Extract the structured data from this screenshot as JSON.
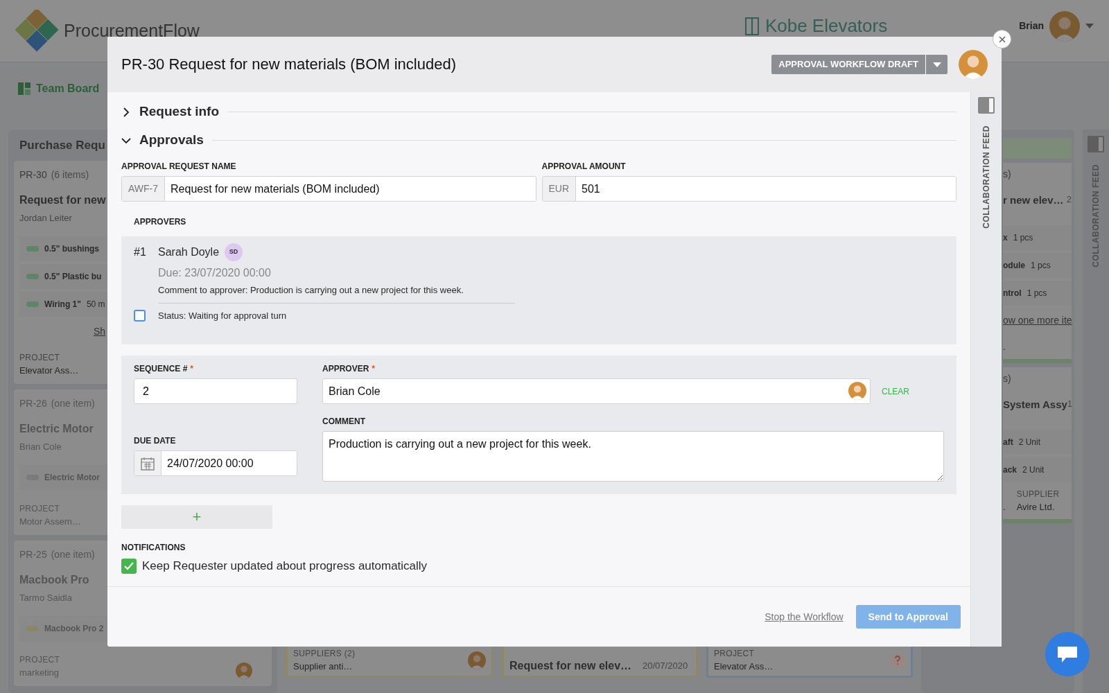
{
  "app": {
    "name": "ProcurementFlow",
    "company": "Kobe Elevators",
    "user": "Brian"
  },
  "nav": {
    "board": "Team Board"
  },
  "left_column": {
    "title": "Purchase Requ",
    "cards": [
      {
        "id": "PR-30",
        "count": "(6 items)",
        "title": "Request for new",
        "requester": "Jordan Leiter",
        "faded": false,
        "items": [
          {
            "name": "0.5\" bushings",
            "color": "#5f8466"
          },
          {
            "name": "0.5\" Plastic bu",
            "color": "#5f8466"
          },
          {
            "name": "Wiring 1\"",
            "qty": "50 m",
            "color": "#5f8466"
          }
        ],
        "link": "Sh",
        "field_label": "PROJECT",
        "field_value": "Elevator Ass…"
      },
      {
        "id": "PR-26",
        "count": "(one item)",
        "title": "Electric Motor",
        "requester": "Brian Cole",
        "faded": true,
        "items": [
          {
            "name": "Electric Motor",
            "color": "#7b7b7b"
          }
        ],
        "field_label": "PROJECT",
        "field_value": "Motor Assem…"
      },
      {
        "id": "PR-25",
        "count": "(one item)",
        "title": "Macbook Pro",
        "requester": "Tarmo Saidla",
        "faded": true,
        "items": [
          {
            "name": "Macbook Pro 2",
            "color": "#8d8666"
          }
        ],
        "field_label": "PROJECT",
        "field_value": "marketing",
        "avatar": true
      }
    ]
  },
  "bottom_cards": [
    {
      "kind": "supplier",
      "label": "SUPPLIERS (2)",
      "value": "Supplier anti…",
      "color": "#8f8766"
    },
    {
      "kind": "request",
      "title": "Request for new elev…",
      "date": "20/07/2020",
      "color": "#8f8766"
    },
    {
      "kind": "project",
      "label": "PROJECT",
      "value": "Elevator Ass…",
      "color": "#6f8092"
    }
  ],
  "right_column": {
    "cards": [
      {
        "count": "s)",
        "title": "r new elev…",
        "date": "2",
        "items": [
          {
            "name": "x",
            "qty": "1 pcs"
          },
          {
            "name": "odule",
            "qty": "1 pcs"
          },
          {
            "name": "ntrol",
            "qty": "1 pcs"
          }
        ],
        "link": "ow one more ite",
        "fields": [
          {
            "value": "."
          }
        ]
      },
      {
        "count": "s)",
        "title": "System Assy",
        "date": "1",
        "items": [
          {
            "name": "aft",
            "qty": "2 Unit"
          },
          {
            "name": "ack",
            "qty": "2 Unit"
          }
        ],
        "fields": [
          {
            "value": "."
          },
          {
            "label": "SUPPLIER",
            "value": "Avire Ltd."
          }
        ]
      }
    ]
  },
  "right_sidebar": {
    "label": "COLLABORATION FEED"
  },
  "modal": {
    "title": "PR-30 Request for new materials (BOM included)",
    "status_button": "APPROVAL WORKFLOW DRAFT",
    "sections": [
      {
        "title": "Request info",
        "expanded": false
      },
      {
        "title": "Approvals",
        "expanded": true
      }
    ],
    "request_name": {
      "label": "APPROVAL REQUEST NAME",
      "prefix": "AWF-7",
      "value": "Request for new materials (BOM included)"
    },
    "amount": {
      "label": "APPROVAL AMOUNT",
      "prefix": "EUR",
      "value": "501"
    },
    "approvers_label": "APPROVERS",
    "approvers": [
      {
        "number": "#1",
        "name": "Sarah Doyle",
        "initials": "SD",
        "due": "Due: 23/07/2020 00:00",
        "comment": "Comment to approver: Production is carrying out a new project for this week.",
        "status": "Status: Waiting for approval turn",
        "checked": false
      }
    ],
    "new_approver": {
      "sequence_label": {
        "text": "SEQUENCE #",
        "mark": "*"
      },
      "sequence": "2",
      "approver_label": {
        "text": "APPROVER",
        "mark": "*"
      },
      "approver": "Brian Cole",
      "clear": "CLEAR",
      "due_label": "DUE DATE",
      "due": "24/07/2020 00:00",
      "comment_label": "COMMENT",
      "comment": "Production is carrying out a new project for this week."
    },
    "add_button": "+",
    "notifications": {
      "label": "NOTIFICATIONS",
      "option": "Keep Requester updated about progress automatically",
      "checked": true
    },
    "footer": {
      "stop": "Stop the Workflow",
      "send": "Send to Approval",
      "send_disabled": true
    },
    "sidebar": {
      "label": "COLLABORATION FEED"
    }
  }
}
